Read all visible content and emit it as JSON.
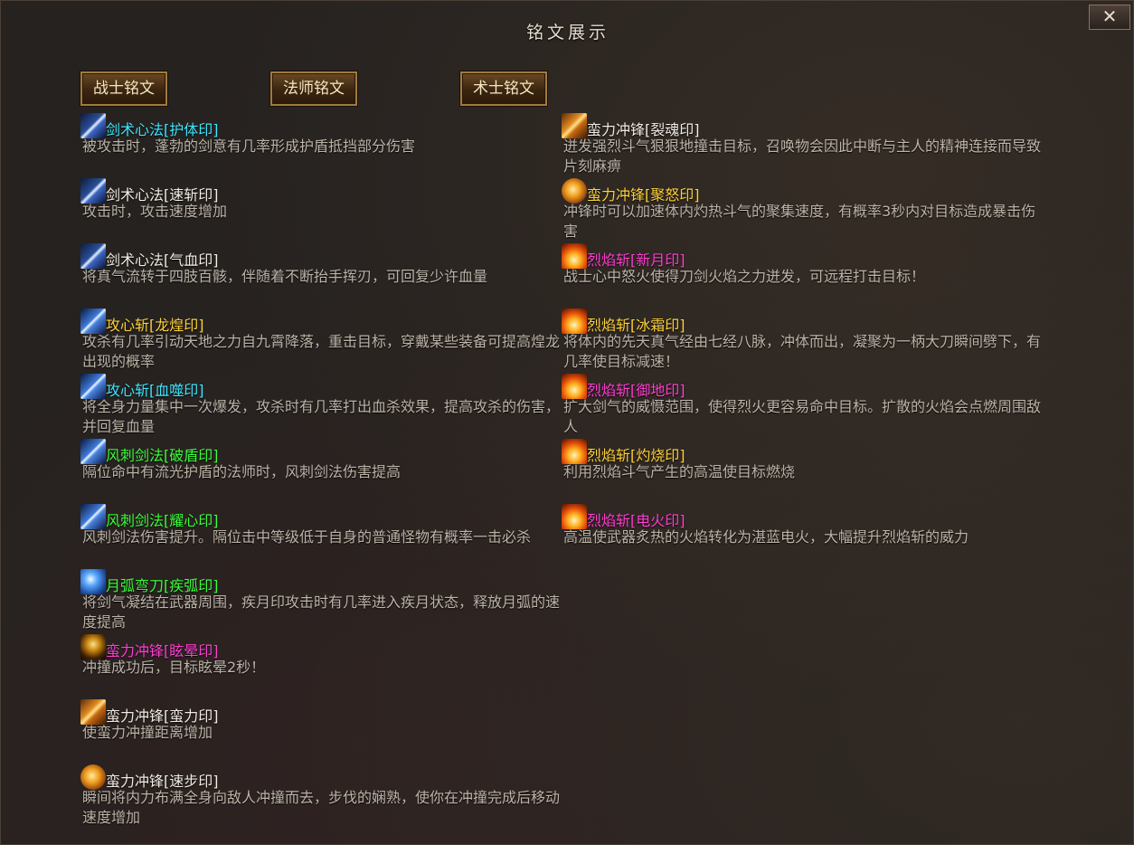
{
  "window": {
    "title": "铭文展示",
    "close_label": "✕"
  },
  "tabs": [
    "战士铭文",
    "法师铭文",
    "术士铭文"
  ],
  "colors": {
    "cyan": "#3fe6ff",
    "white": "#f2ece2",
    "yellow": "#ffd23a",
    "magenta": "#ff3fd2",
    "green": "#3cff3c"
  },
  "left_column": [
    {
      "icon": "sword-icon",
      "name": "剑术心法[护体印]",
      "color": "cyan",
      "desc": "被攻击时，蓬勃的剑意有几率形成护盾抵挡部分伤害"
    },
    {
      "icon": "sword-icon",
      "name": "剑术心法[速斩印]",
      "color": "white",
      "desc": "攻击时，攻击速度增加"
    },
    {
      "icon": "sword-icon",
      "name": "剑术心法[气血印]",
      "color": "white",
      "desc": "将真气流转于四肢百骸，伴随着不断抬手挥刃，可回复少许血量"
    },
    {
      "icon": "sword2-icon",
      "name": "攻心斩[龙煌印]",
      "color": "yellow",
      "desc": "攻杀有几率引动天地之力自九霄降落，重击目标，穿戴某些装备可提高煌龙出现的概率"
    },
    {
      "icon": "sword2-icon",
      "name": "攻心斩[血噬印]",
      "color": "cyan",
      "desc": "将全身力量集中一次爆发，攻杀时有几率打出血杀效果，提高攻杀的伤害，并回复血量"
    },
    {
      "icon": "sword2-icon",
      "name": "风刺剑法[破盾印]",
      "color": "green",
      "desc": "隔位命中有流光护盾的法师时，风刺剑法伤害提高"
    },
    {
      "icon": "sword2-icon",
      "name": "风刺剑法[耀心印]",
      "color": "green",
      "desc": "风刺剑法伤害提升。隔位击中等级低于自身的普通怪物有概率一击必杀"
    },
    {
      "icon": "crescent-icon",
      "name": "月弧弯刀[疾弧印]",
      "color": "green",
      "desc": "将剑气凝结在武器周围，疾月印攻击时有几率进入疾月状态，释放月弧的速度提高"
    },
    {
      "icon": "person-icon",
      "name": "蛮力冲锋[眩晕印]",
      "color": "magenta",
      "desc": "冲撞成功后，目标眩晕2秒！"
    },
    {
      "icon": "dash-icon",
      "name": "蛮力冲锋[蛮力印]",
      "color": "white",
      "desc": "使蛮力冲撞距离增加"
    },
    {
      "icon": "dashcircle-icon",
      "name": "蛮力冲锋[速步印]",
      "color": "white",
      "desc": "瞬间将内力布满全身向敌人冲撞而去，步伐的娴熟，使你在冲撞完成后移动速度增加"
    }
  ],
  "right_column": [
    {
      "icon": "dash-icon",
      "name": "蛮力冲锋[裂魂印]",
      "color": "white",
      "desc": "迸发强烈斗气狠狠地撞击目标，召唤物会因此中断与主人的精神连接而导致片刻麻痹"
    },
    {
      "icon": "dashcircle-icon",
      "name": "蛮力冲锋[聚怒印]",
      "color": "yellow",
      "desc": "冲锋时可以加速体内灼热斗气的聚集速度，有概率3秒内对目标造成暴击伤害"
    },
    {
      "icon": "fire-icon",
      "name": "烈焰斩[新月印]",
      "color": "magenta",
      "desc": "战士心中怒火使得刀剑火焰之力迸发，可远程打击目标！"
    },
    {
      "icon": "fire-icon",
      "name": "烈焰斩[冰霜印]",
      "color": "yellow",
      "desc": "将体内的先天真气经由七经八脉，冲体而出，凝聚为一柄大刀瞬间劈下，有几率使目标减速！"
    },
    {
      "icon": "fire-icon",
      "name": "烈焰斩[御地印]",
      "color": "magenta",
      "desc": "扩大剑气的威慑范围，使得烈火更容易命中目标。扩散的火焰会点燃周围敌人"
    },
    {
      "icon": "fire-icon",
      "name": "烈焰斩[灼烧印]",
      "color": "yellow",
      "desc": "利用烈焰斗气产生的高温使目标燃烧"
    },
    {
      "icon": "fire-icon",
      "name": "烈焰斩[电火印]",
      "color": "magenta",
      "desc": "高温使武器炙热的火焰转化为湛蓝电火，大幅提升烈焰斩的威力"
    }
  ]
}
